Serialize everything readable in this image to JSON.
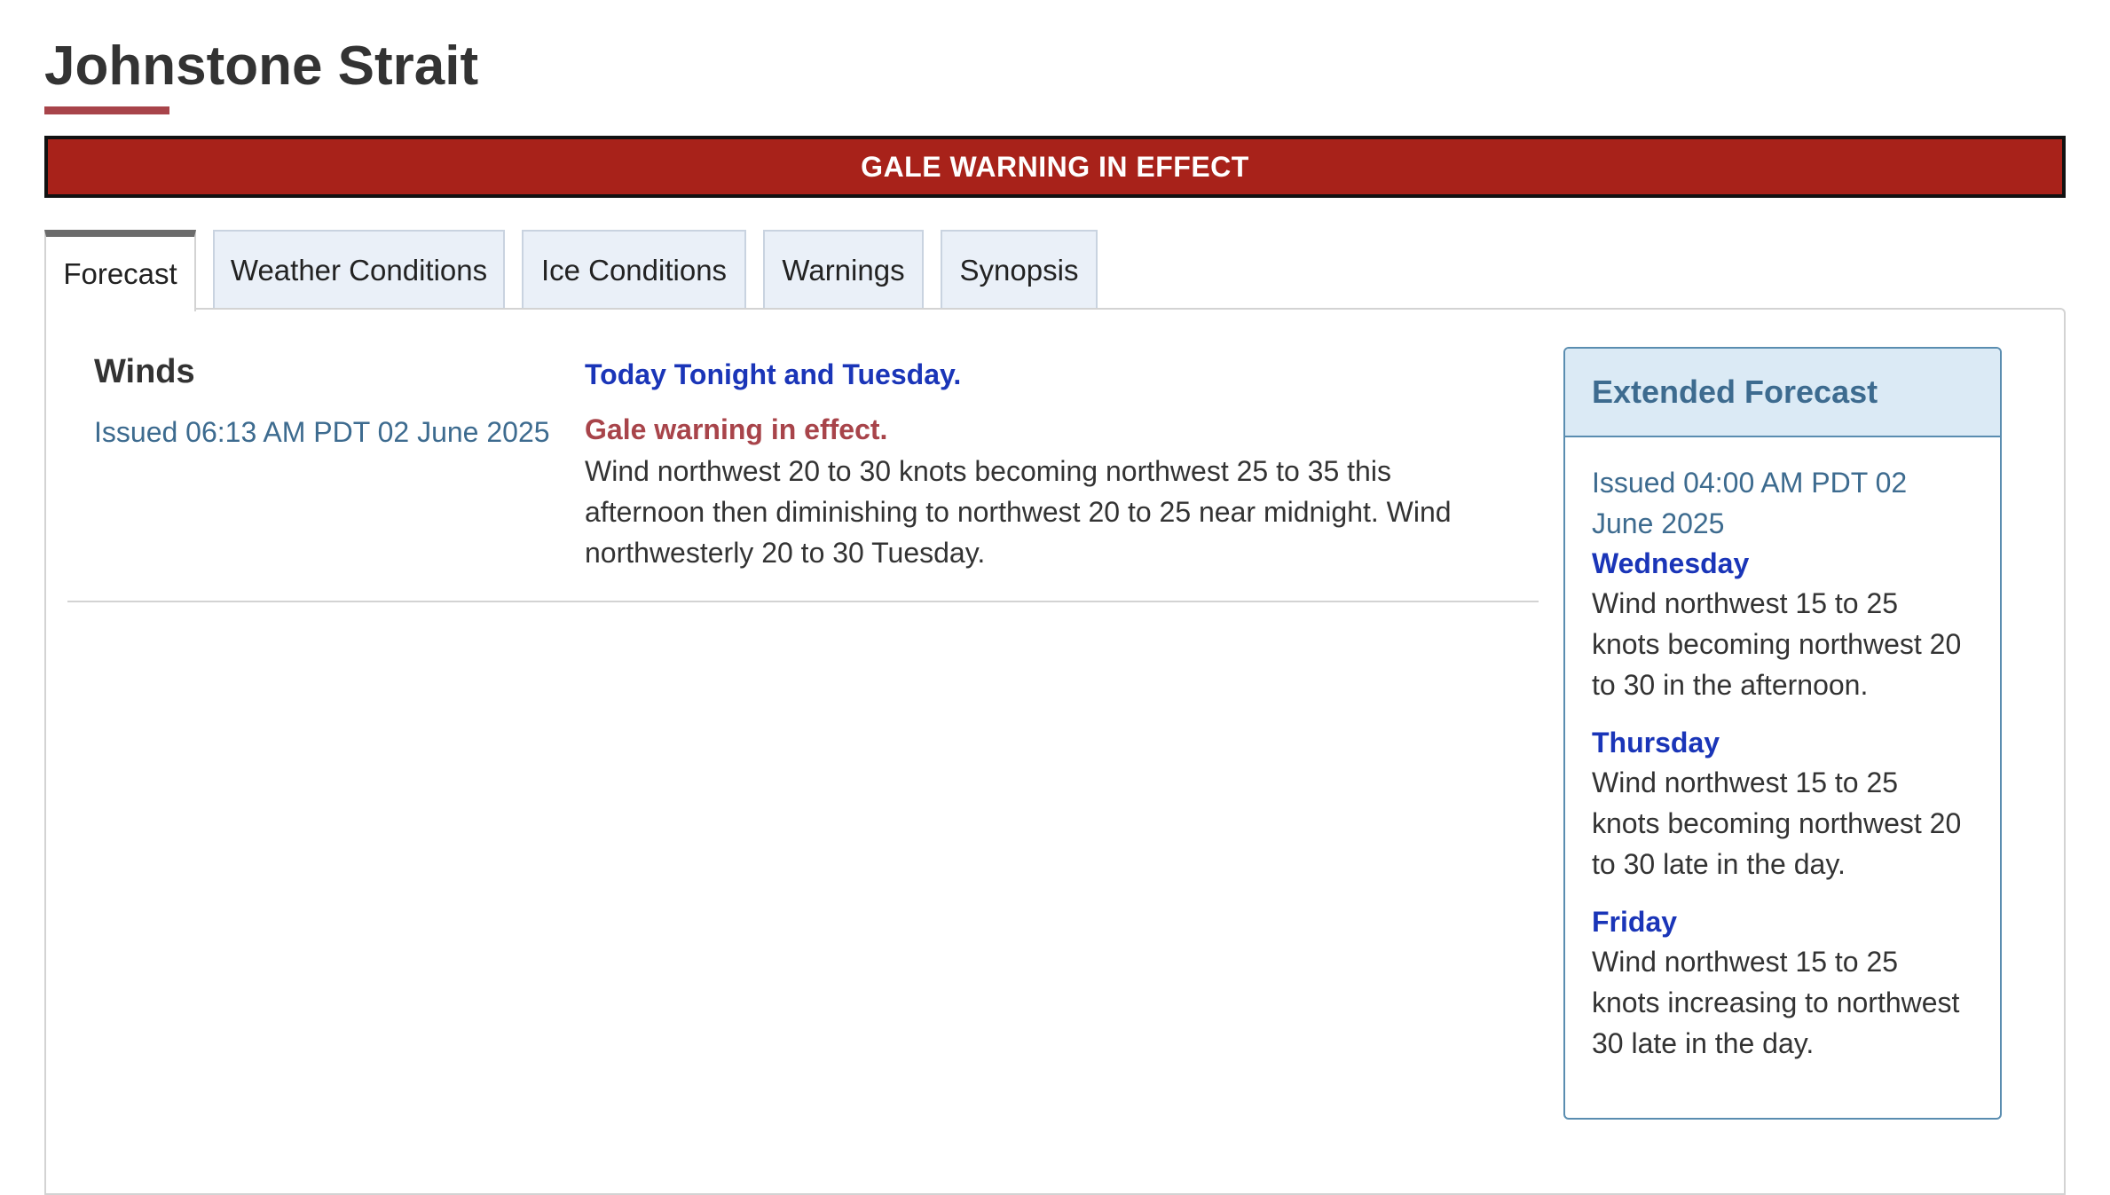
{
  "page": {
    "title": "Johnstone Strait"
  },
  "alert": {
    "text": "GALE WARNING IN EFFECT"
  },
  "tabs": [
    {
      "label": "Forecast",
      "active": true
    },
    {
      "label": "Weather Conditions",
      "active": false
    },
    {
      "label": "Ice Conditions",
      "active": false
    },
    {
      "label": "Warnings",
      "active": false
    },
    {
      "label": "Synopsis",
      "active": false
    }
  ],
  "winds": {
    "heading": "Winds",
    "issued": "Issued 06:13 AM PDT 02 June 2025",
    "period_title": "Today Tonight and Tuesday.",
    "warning": "Gale warning in effect.",
    "text": "Wind northwest 20 to 30 knots becoming northwest 25 to 35 this afternoon then diminishing to northwest 20 to 25 near midnight. Wind northwesterly 20 to 30 Tuesday."
  },
  "extended": {
    "title": "Extended Forecast",
    "issued": "Issued 04:00 AM PDT 02 June 2025",
    "days": [
      {
        "name": "Wednesday",
        "text": "Wind northwest 15 to 25 knots becoming northwest 20 to 30 in the afternoon."
      },
      {
        "name": "Thursday",
        "text": "Wind northwest 15 to 25 knots becoming northwest 20 to 30 late in the day."
      },
      {
        "name": "Friday",
        "text": "Wind northwest 15 to 25 knots increasing to northwest 30 late in the day."
      }
    ]
  },
  "colors": {
    "alert_bg": "#a8221a",
    "title_underline": "#a8444a",
    "link_blue": "#1a35b8",
    "issued_teal": "#3d6b8f",
    "warning_red": "#a8444a",
    "tab_bg": "#eaf0f8",
    "ext_header_bg": "#dbeaf5"
  }
}
